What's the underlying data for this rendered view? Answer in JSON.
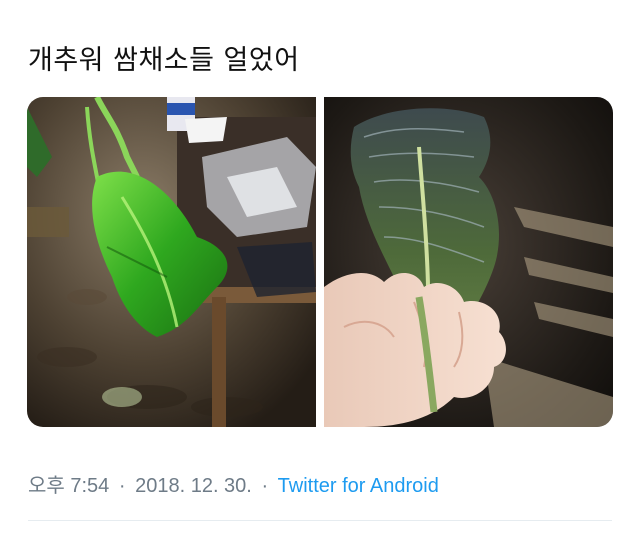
{
  "tweet": {
    "text": "개추워 쌈채소들 얼었어"
  },
  "media": {
    "photo_left": "frozen-green-lettuce-photo",
    "photo_right": "frozen-red-lettuce-photo"
  },
  "meta": {
    "time": "오후 7:54",
    "separator": "·",
    "date": "2018. 12. 30.",
    "separator2": "·",
    "source": "Twitter for Android"
  },
  "colors": {
    "text": "#111111",
    "meta": "#6e7b87",
    "link": "#1d9bf0"
  }
}
